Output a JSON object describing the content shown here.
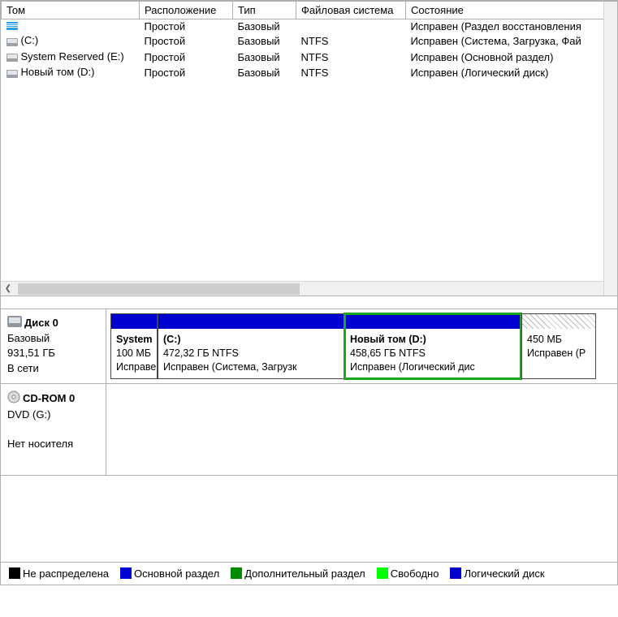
{
  "columns": {
    "volume": "Том",
    "layout": "Расположение",
    "type": "Тип",
    "fs": "Файловая система",
    "status": "Состояние"
  },
  "volumes": [
    {
      "name": "",
      "icon": "striped",
      "layout": "Простой",
      "type": "Базовый",
      "fs": "",
      "status": "Исправен (Раздел восстановления"
    },
    {
      "name": "(C:)",
      "icon": "drive",
      "layout": "Простой",
      "type": "Базовый",
      "fs": "NTFS",
      "status": "Исправен (Система, Загрузка, Фай"
    },
    {
      "name": "System Reserved (E:)",
      "icon": "drive",
      "layout": "Простой",
      "type": "Базовый",
      "fs": "NTFS",
      "status": "Исправен (Основной раздел)"
    },
    {
      "name": "Новый том (D:)",
      "icon": "drive",
      "layout": "Простой",
      "type": "Базовый",
      "fs": "NTFS",
      "status": "Исправен (Логический диск)"
    }
  ],
  "disk0": {
    "title": "Диск 0",
    "type": "Базовый",
    "size": "931,51 ГБ",
    "state": "В сети",
    "parts": [
      {
        "title": "System",
        "line2": "100 МБ",
        "line3": "Исправе"
      },
      {
        "title": "(C:)",
        "line2": "472,32 ГБ NTFS",
        "line3": "Исправен (Система, Загрузк"
      },
      {
        "title": "Новый том  (D:)",
        "line2": "458,65 ГБ NTFS",
        "line3": "Исправен (Логический дис"
      },
      {
        "title": "",
        "line2": "450 МБ",
        "line3": "Исправен (Р"
      }
    ]
  },
  "cdrom": {
    "title": "CD-ROM 0",
    "type": "DVD (G:)",
    "state": "Нет носителя"
  },
  "legend": {
    "unalloc": "Не распределена",
    "primary": "Основной раздел",
    "extended": "Дополнительный раздел",
    "free": "Свободно",
    "logical": "Логический диск"
  }
}
